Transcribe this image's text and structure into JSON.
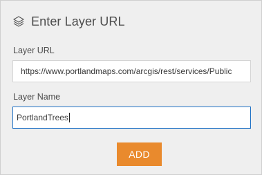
{
  "dialog": {
    "title": "Enter Layer URL",
    "icon": "layers-icon"
  },
  "layer_url": {
    "label": "Layer URL",
    "value": "https://www.portlandmaps.com/arcgis/rest/services/Public"
  },
  "layer_name": {
    "label": "Layer Name",
    "value": "PortlandTrees"
  },
  "actions": {
    "add_label": "ADD"
  },
  "colors": {
    "accent_button": "#e98a2d",
    "focus_border": "#1c6fc4",
    "panel_bg": "#efefef"
  }
}
